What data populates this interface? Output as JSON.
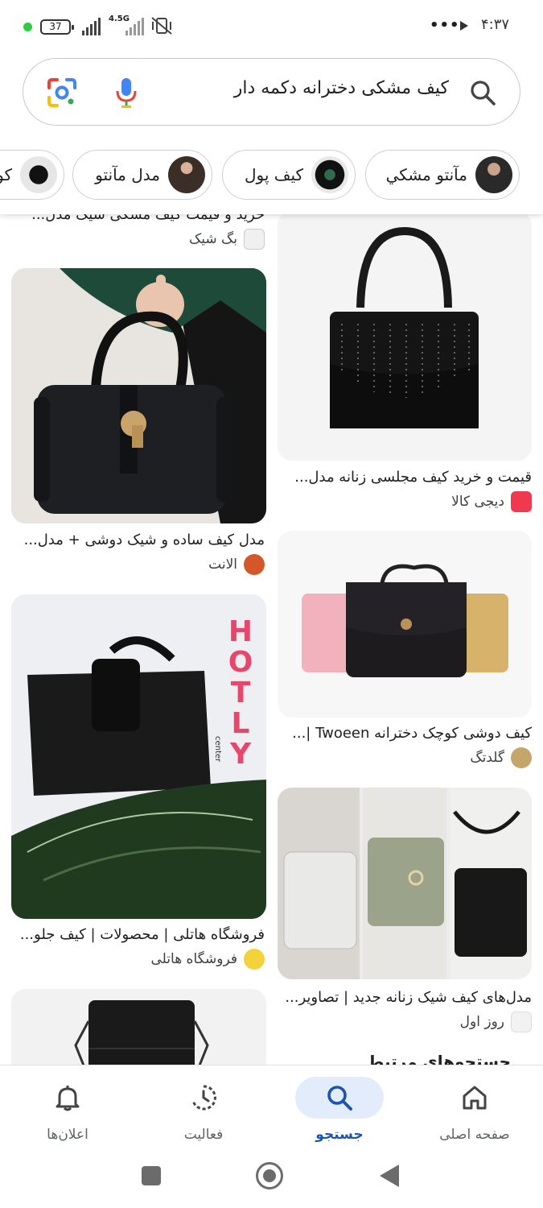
{
  "status_bar": {
    "battery": "37",
    "network": "4.5G",
    "more": "•••",
    "time": "۴:۳۷"
  },
  "search": {
    "query": "کیف مشکی دخترانه دکمه دار"
  },
  "chips": [
    {
      "label": "مآنتو مشكي"
    },
    {
      "label": "كيف پول"
    },
    {
      "label": "مدل مآنتو"
    },
    {
      "label": "كو"
    }
  ],
  "results": [
    {
      "title": "خرید و قیمت کیف مشکی شیک مدل...",
      "source": "بگ شیک"
    },
    {
      "title": "قیمت و خرید کیف مجلسی زنانه مدل...",
      "source": "دیجی کالا"
    },
    {
      "title": "مدل کیف ساده و شیک دوشی + مدل...",
      "source": "الانت"
    },
    {
      "title": "کیف دوشی کوچک دخترانه Twoeen |...",
      "source": "گلدتگ"
    },
    {
      "title": "فروشگاه هاتلی | محصولات | کیف جلو...",
      "source": "فروشگاه هاتلی"
    },
    {
      "title": "مدل‌های کیف شیک زنانه جدید | تصاویر...",
      "source": "روز اول"
    },
    {
      "title": "جستجوهای مرتبط",
      "source": ""
    }
  ],
  "image_text": {
    "hotly_brand": "HOTLY",
    "hotly_sub": "center"
  },
  "bottom_nav": [
    {
      "label": "صفحه اصلی"
    },
    {
      "label": "جستجو"
    },
    {
      "label": "فعالیت"
    },
    {
      "label": "اعلان‌ها"
    }
  ],
  "colors": {
    "accent": "#1a56b0",
    "active_pill": "#e3ecfb"
  }
}
